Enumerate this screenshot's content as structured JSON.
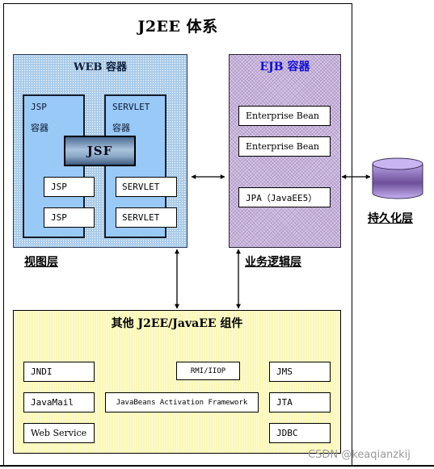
{
  "title": "J2EE 体系",
  "web_container": {
    "title": "WEB 容器",
    "jsp_container": {
      "label_line1": "JSP",
      "label_line2": "容器",
      "items": [
        "JSP",
        "JSP"
      ]
    },
    "servlet_container": {
      "label_line1": "SERVLET",
      "label_line2": "容器",
      "items": [
        "SERVLET",
        "SERVLET"
      ]
    },
    "jsf_label": "JSF",
    "layer_label": "视图层",
    "color": "#a9cbe9"
  },
  "ejb_container": {
    "title": "EJB 容器",
    "title_color": "#1010d8",
    "items": [
      "Enterprise Bean",
      "Enterprise Bean",
      "JPA（JavaEE5）"
    ],
    "layer_label": "业务逻辑层",
    "color": "#d7c8e6"
  },
  "persistence": {
    "icon": "database-cylinder-icon",
    "layer_label": "持久化层",
    "color": "#9a7ccf"
  },
  "other_components": {
    "title": "其他 J2EE/JavaEE 组件",
    "color": "#fbf8b8",
    "items": {
      "jndi": "JNDI",
      "javamail": "JavaMail",
      "web_service": "Web Service",
      "rmi_iiop": "RMI/IIOP",
      "jaf": "JavaBeans Activation Framework",
      "jms": "JMS",
      "jta": "JTA",
      "jdbc": "JDBC"
    }
  },
  "connections": [
    {
      "from": "WEB 容器",
      "to": "EJB 容器",
      "type": "bidirectional"
    },
    {
      "from": "EJB 容器",
      "to": "持久化层",
      "type": "bidirectional"
    },
    {
      "from": "WEB 容器",
      "to": "其他 J2EE/JavaEE 组件",
      "type": "bidirectional"
    },
    {
      "from": "EJB 容器",
      "to": "其他 J2EE/JavaEE 组件",
      "type": "bidirectional"
    }
  ],
  "watermark": "CSDN @keaqianzkij"
}
